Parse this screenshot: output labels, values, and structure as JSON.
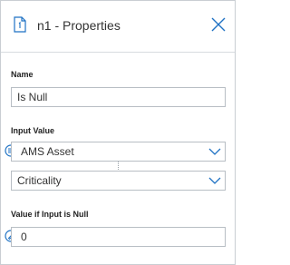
{
  "header": {
    "title": "n1 - Properties",
    "icon": "document-icon",
    "close_icon": "close-icon"
  },
  "name_section": {
    "label": "Name",
    "value": "Is Null"
  },
  "input_section": {
    "label": "Input Value",
    "source_icon": "list-icon",
    "source_value": "AMS Asset",
    "field_value": "Criticality"
  },
  "null_section": {
    "label": "Value if Input is Null",
    "edit_icon": "pencil-icon",
    "value": "0"
  },
  "colors": {
    "accent": "#1f72c4",
    "border": "#b8bec4"
  }
}
